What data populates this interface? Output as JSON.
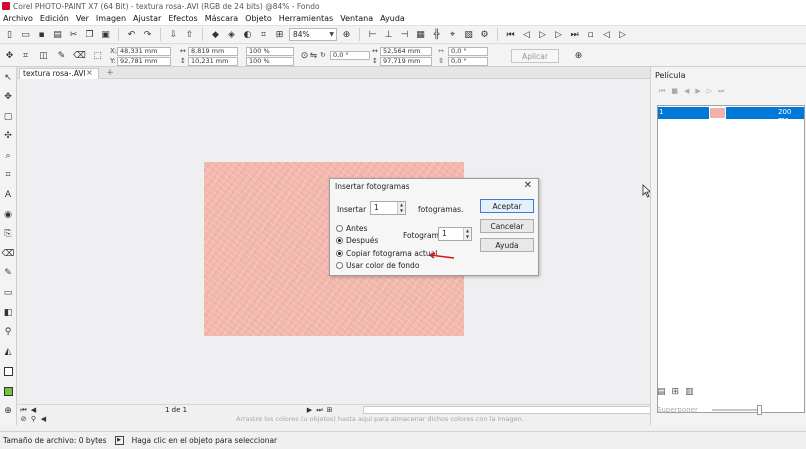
{
  "window": {
    "title": "Corel PHOTO-PAINT X7 (64 Bit) - textura rosa-.AVI (RGB de 24 bits) @84% - Fondo"
  },
  "menu": [
    "Archivo",
    "Edición",
    "Ver",
    "Imagen",
    "Ajustar",
    "Efectos",
    "Máscara",
    "Objeto",
    "Herramientas",
    "Ventana",
    "Ayuda"
  ],
  "toolbar": {
    "zoom": "84%"
  },
  "property_bar": {
    "x": "48,331 mm",
    "y": "92,781 mm",
    "w": "8,819 mm",
    "h": "10,231 mm",
    "scale_w": "100 %",
    "scale_h": "100 %",
    "rotation": "0,0 °",
    "center_x": "52,564 mm",
    "center_y": "97,719 mm",
    "skew_h": "0,0 °",
    "skew_v": "0,0 °",
    "apply_label": "Aplicar"
  },
  "document_tab": {
    "label": "textura rosa-.AVI"
  },
  "dialog": {
    "title": "Insertar fotogramas",
    "insert_label": "Insertar",
    "insert_value": "1",
    "frames_label": "fotogramas.",
    "before_label": "Antes",
    "after_label": "Después",
    "frame_label": "Fotograma:",
    "frame_value": "1",
    "copy_label": "Copiar fotograma actual",
    "bgcolor_label": "Usar color de fondo",
    "selected_position": "Después",
    "selected_fill": "Copiar fotograma actual",
    "ok_label": "Aceptar",
    "cancel_label": "Cancelar",
    "help_label": "Ayuda"
  },
  "bottom_bar": {
    "page_indicator": "1 de 1",
    "hint": "Arrastre los colores (u objetos) hasta aquí para almacenar dichos colores con la imagen."
  },
  "status": {
    "file_size": "Tamaño de archivo: 0 bytes",
    "message": "Haga clic en el objeto para seleccionar"
  },
  "film_panel": {
    "title": "Película",
    "frames": [
      {
        "number": "1",
        "duration": "200 ms"
      }
    ],
    "overlay_label": "Superponer"
  },
  "colors": {
    "accent": "#0078d7",
    "texture": "#f2b8ae",
    "annotation_arrow": "#d11a1a"
  }
}
